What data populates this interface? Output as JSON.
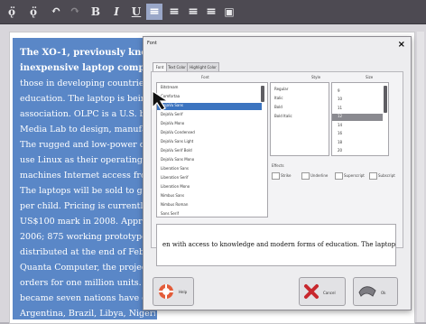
{
  "toolbar": {
    "items": [
      {
        "label": "ǫ̈",
        "icon": "increase-font-icon"
      },
      {
        "label": "ǫ̈",
        "icon": "decrease-font-icon"
      },
      {
        "label": "↶",
        "icon": "undo-icon"
      },
      {
        "label": "↷",
        "icon": "redo-icon"
      },
      {
        "label": "B",
        "icon": "bold-icon"
      },
      {
        "label": "I",
        "icon": "italic-icon"
      },
      {
        "label": "U",
        "icon": "underline-icon"
      },
      {
        "label": "≡",
        "icon": "align-left-icon"
      },
      {
        "label": "≡",
        "icon": "align-center-icon"
      },
      {
        "label": "≡",
        "icon": "align-right-icon"
      },
      {
        "label": "≡",
        "icon": "justify-icon"
      },
      {
        "label": "▣",
        "icon": "insert-image-icon"
      }
    ]
  },
  "document": {
    "lines": [
      "The XO-1, previously known",
      "inexpensive laptop computer",
      "those in developing countries, w",
      "education. The laptop is being d",
      "association. OLPC is a U.S. ba",
      "Media Lab to design, manufact",
      "The rugged and low-power com",
      "use Linux as their operating sys",
      "machines Internet access from",
      "The laptops will be sold to gove",
      "per child. Pricing is currently e",
      "US$100 mark in 2008. Approx",
      "2006; 875 working prototypes (",
      "distributed at the end of Februa",
      "Quanta Computer, the project's",
      "orders for one million units. Th",
      "became seven nations have co",
      "Argentina, Brazil, Libya, Nigeri"
    ]
  },
  "dialog": {
    "title": "Font",
    "close_label": "×",
    "tabs": [
      "Font",
      "Text Color",
      "Highlight Color"
    ],
    "columns": {
      "font": "Font",
      "style": "Style",
      "size": "Size"
    },
    "fonts": [
      "Bitstream",
      "Comfortaa",
      "DejaVu Sans",
      "DejaVu Serif",
      "DejaVu Mono",
      "DejaVu Condensed",
      "DejaVu Sans Light",
      "DejaVu Serif Bold",
      "DejaVu Sans Mono",
      "Liberation Sans",
      "Liberation Serif",
      "Liberation Mono",
      "Nimbus Sans",
      "Nimbus Roman",
      "Sans Serif",
      "Serif",
      "Monospace"
    ],
    "selected_font_index": 2,
    "styles": [
      "Regular",
      "Italic",
      "Bold",
      "Bold Italic"
    ],
    "sizes": [
      "8",
      "9",
      "10",
      "11",
      "12",
      "14",
      "16",
      "18",
      "20"
    ],
    "selected_size_index": 4,
    "effects_label": "Effects",
    "effects": [
      "Strike",
      "Underline",
      "Superscript",
      "Subscript"
    ],
    "preview_text": "en with access to knowledge and modern forms of education. The laptop is b",
    "buttons": {
      "help": "Help",
      "cancel": "Cancel",
      "ok": "Ok"
    }
  }
}
